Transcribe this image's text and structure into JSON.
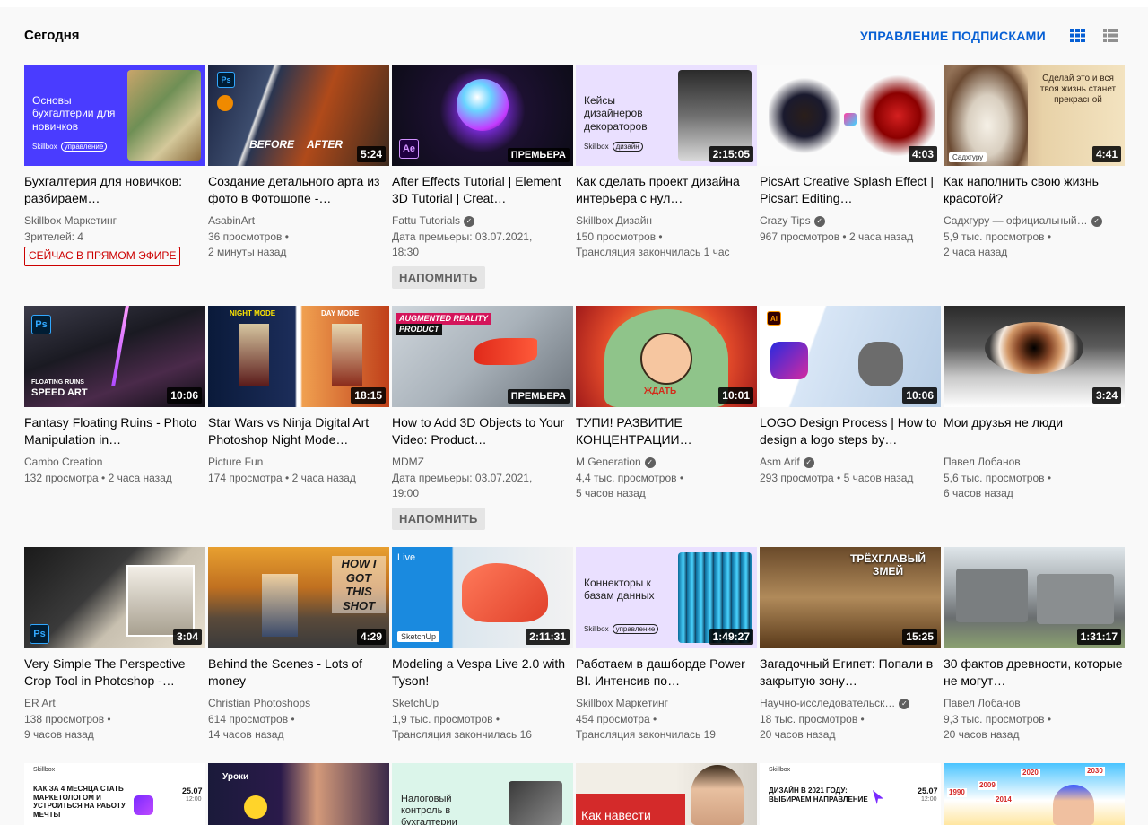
{
  "section": {
    "title": "Сегодня",
    "manage_label": "УПРАВЛЕНИЕ ПОДПИСКАМИ"
  },
  "icons": {
    "grid": "grid-view-icon",
    "list": "list-view-icon",
    "verified": "check-icon"
  },
  "colors": {
    "link": "#065fd4",
    "live": "#cc0000"
  },
  "rows": [
    [
      {
        "title": "Бухгалтерия для новичков: разбираем…",
        "channel": "Skillbox Маркетинг",
        "verified": false,
        "line1": "Зрителей: 4",
        "line2": "",
        "live": "СЕЙЧАС В ПРЯМОМ ЭФИРЕ",
        "thumb_text": "Основы бухгалтерии для новичков",
        "thumb_sub": "Skillbox",
        "thumb_tag": "управление"
      },
      {
        "title": "Создание детального арта из фото в Фотошопе -…",
        "channel": "AsabinArt",
        "verified": false,
        "line1": "36 просмотров •",
        "line2": "2 минуты назад",
        "duration": "5:24",
        "thumb_text": "BEFORE",
        "thumb_text2": "AFTER"
      },
      {
        "title": "After Effects Tutorial | Element 3D Tutorial | Creat…",
        "channel": "Fattu Tutorials",
        "verified": true,
        "line1": "Дата премьеры: 03.07.2021,",
        "line2": "18:30",
        "premiere": "ПРЕМЬЕРА",
        "remind": "НАПОМНИТЬ",
        "badge": "Ae"
      },
      {
        "title": "Как сделать проект дизайна интерьера с нул…",
        "channel": "Skillbox Дизайн",
        "verified": false,
        "line1": "150 просмотров •",
        "line2": "Трансляция закончилась 1 час",
        "duration": "2:15:05",
        "thumb_text": "Кейсы дизайнеров декораторов",
        "thumb_sub": "Skillbox",
        "thumb_tag": "дизайн"
      },
      {
        "title": "PicsArt Creative Splash Effect | Picsart Editing…",
        "channel": "Crazy Tips",
        "verified": true,
        "line1": "967 просмотров • 2 часа назад",
        "line2": "",
        "duration": "4:03"
      },
      {
        "title": "Как наполнить свою жизнь красотой?",
        "channel": "Садхгуру — официальный…",
        "verified": true,
        "line1": "5,9 тыс. просмотров •",
        "line2": "2 часа назад",
        "duration": "4:41",
        "thumb_text": "Сделай это и вся твоя жизнь станет прекрасной",
        "thumb_sub": "Садхгуру"
      }
    ],
    [
      {
        "title": "Fantasy Floating Ruins - Photo Manipulation in…",
        "channel": "Cambo Creation",
        "verified": false,
        "line1": "132 просмотра • 2 часа назад",
        "line2": "",
        "duration": "10:06",
        "badge": "Ps",
        "thumb_text": "FLOATING RUINS",
        "thumb_text2": "SPEED ART"
      },
      {
        "title": "Star Wars vs Ninja Digital Art Photoshop Night Mode…",
        "channel": "Picture Fun",
        "verified": false,
        "line1": "174 просмотра • 2 часа назад",
        "line2": "",
        "duration": "18:15",
        "thumb_text": "NIGHT MODE",
        "thumb_text2": "DAY MODE"
      },
      {
        "title": "How to Add 3D Objects to Your Video: Product…",
        "channel": "MDMZ",
        "verified": false,
        "line1": "Дата премьеры: 03.07.2021,",
        "line2": "19:00",
        "premiere": "ПРЕМЬЕРА",
        "remind": "НАПОМНИТЬ",
        "thumb_text": "AUGMENTED REALITY",
        "thumb_text2": "PRODUCT"
      },
      {
        "title": "ТУПИ! РАЗВИТИЕ КОНЦЕНТРАЦИИ…",
        "channel": "M Generation",
        "verified": true,
        "line1": "4,4 тыс. просмотров •",
        "line2": "5 часов назад",
        "duration": "10:01",
        "thumb_text": "ЖДАТЬ"
      },
      {
        "title": "LOGO Design Process | How to design a logo steps by…",
        "channel": "Asm Arif",
        "verified": true,
        "line1": "293 просмотра • 5 часов назад",
        "line2": "",
        "duration": "10:06",
        "badge": "Ai"
      },
      {
        "title": "Мои друзья не люди",
        "channel": "Павел Лобанов",
        "verified": false,
        "line1": "5,6 тыс. просмотров •",
        "line2": "6 часов назад",
        "duration": "3:24"
      }
    ],
    [
      {
        "title": "Very Simple The Perspective Crop Tool in Photoshop -…",
        "channel": "ER Art",
        "verified": false,
        "line1": "138 просмотров •",
        "line2": "9 часов назад",
        "duration": "3:04",
        "badge": "Ps"
      },
      {
        "title": "Behind the Scenes - Lots of money",
        "channel": "Christian Photoshops",
        "verified": false,
        "line1": "614 просмотров •",
        "line2": "14 часов назад",
        "duration": "4:29",
        "thumb_text": "HOW I GOT THIS SHOT"
      },
      {
        "title": "Modeling a Vespa Live 2.0 with Tyson!",
        "channel": "SketchUp",
        "verified": false,
        "line1": "1,9 тыс. просмотров •",
        "line2": "Трансляция закончилась 16",
        "duration": "2:11:31",
        "thumb_text": "Live",
        "thumb_text2": "SketchUp"
      },
      {
        "title": "Работаем в дашборде Power BI. Интенсив по…",
        "channel": "Skillbox Маркетинг",
        "verified": false,
        "line1": "454 просмотра •",
        "line2": "Трансляция закончилась 19",
        "duration": "1:49:27",
        "thumb_text": "Коннекторы к базам данных",
        "thumb_sub": "Skillbox",
        "thumb_tag": "управление"
      },
      {
        "title": "Загадочный Египет: Попали в закрытую зону…",
        "channel": "Научно-исследовательск…",
        "verified": true,
        "line1": "18 тыс. просмотров •",
        "line2": "20 часов назад",
        "duration": "15:25",
        "thumb_text": "ТРЁХГЛАВЫЙ ЗМЕЙ"
      },
      {
        "title": "30 фактов древности, которые не могут…",
        "channel": "Павел Лобанов",
        "verified": false,
        "line1": "9,3 тыс. просмотров •",
        "line2": "20 часов назад",
        "duration": "1:31:17"
      }
    ]
  ],
  "bottom_row": [
    {
      "thumb_sub": "Skillbox",
      "thumb_text": "КАК ЗА 4 МЕСЯЦА СТАТЬ МАРКЕТОЛОГОМ И УСТРОИТЬСЯ НА РАБОТУ МЕЧТЫ",
      "date": "25.07",
      "time": "12:00"
    },
    {
      "thumb_text": "Уроки"
    },
    {
      "thumb_text": "Налоговый контроль в бухгалтерии"
    },
    {
      "thumb_text": "Как навести"
    },
    {
      "thumb_sub": "Skillbox",
      "thumb_text": "ДИЗАЙН В 2021 ГОДУ: ВЫБИРАЕМ НАПРАВЛЕНИЕ",
      "date": "25.07",
      "time": "12:00"
    },
    {
      "years": [
        "1990",
        "2009",
        "2014",
        "2020",
        "2030"
      ]
    }
  ]
}
